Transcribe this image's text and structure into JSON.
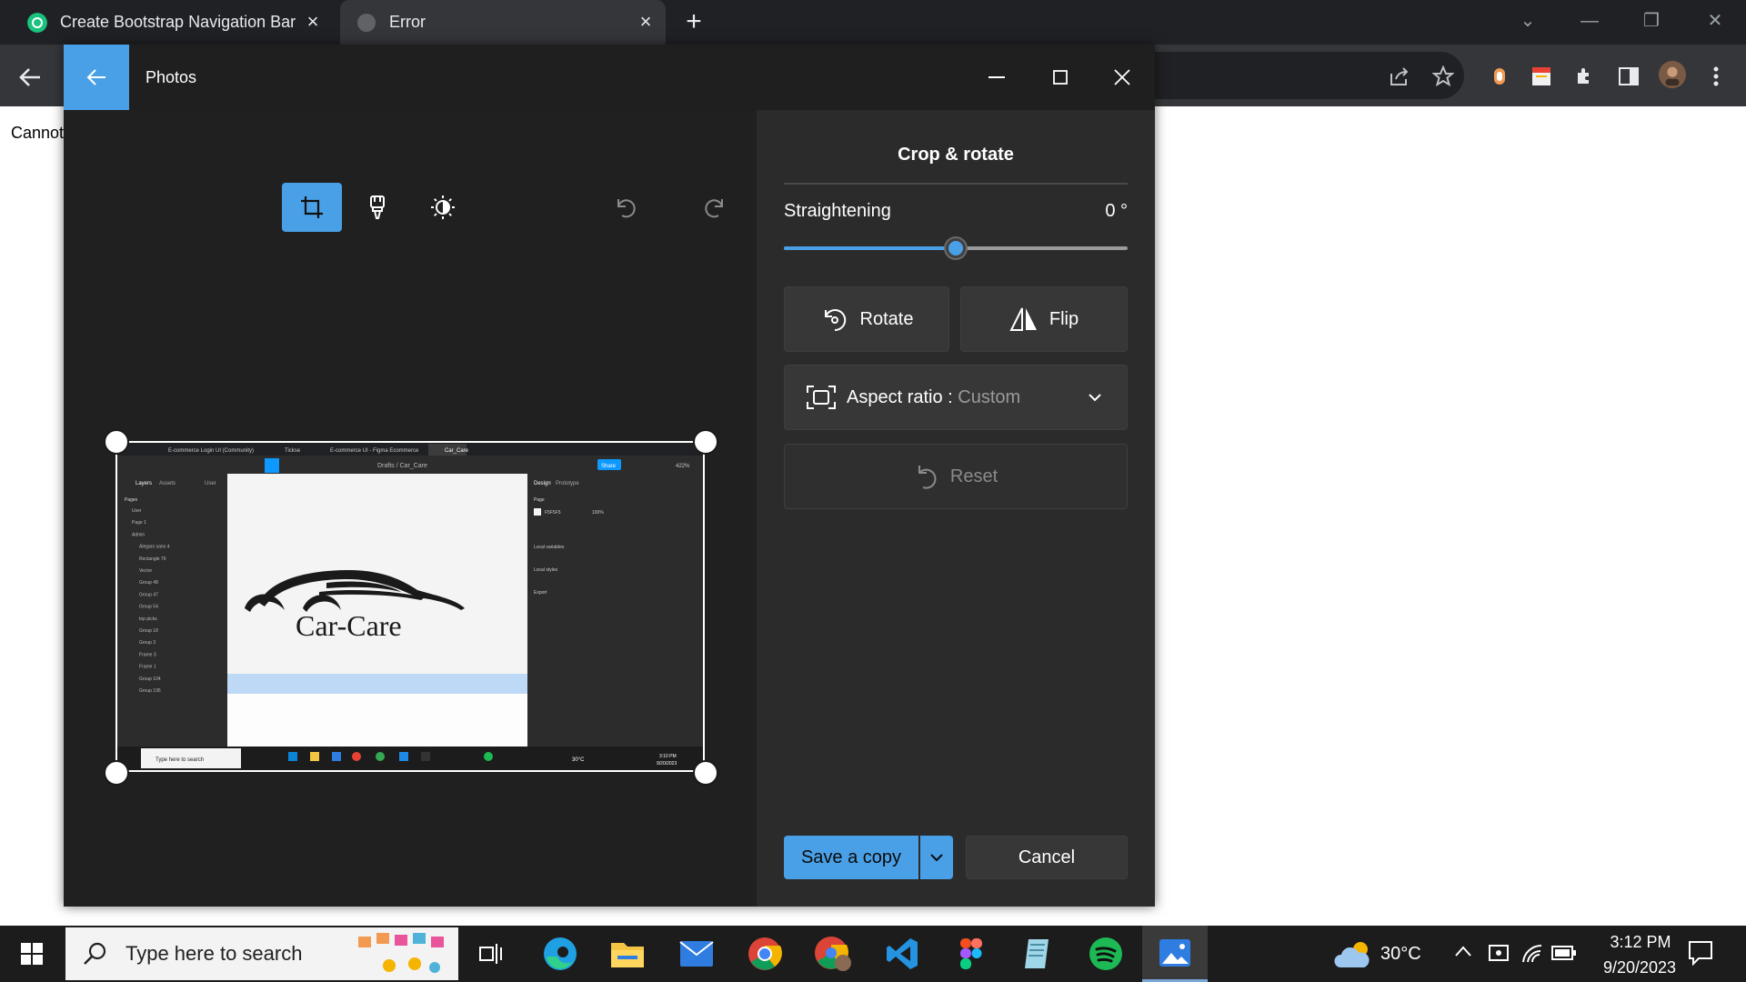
{
  "browser": {
    "tabs": [
      {
        "title": "Create Bootstrap Navigation Bar",
        "active": false
      },
      {
        "title": "Error",
        "active": true
      }
    ],
    "page_text": "Cannot"
  },
  "photos": {
    "app_title": "Photos",
    "panel_title": "Crop & rotate",
    "straightening_label": "Straightening",
    "straightening_value": "0 °",
    "straightening_level": 0.5,
    "rotate_label": "Rotate",
    "flip_label": "Flip",
    "aspect_label": "Aspect ratio : ",
    "aspect_value": "Custom",
    "reset_label": "Reset",
    "save_label": "Save a copy",
    "cancel_label": "Cancel",
    "accent_color": "#4aa0e6"
  },
  "preview": {
    "tabs": [
      "E-commerce Login UI (Community)",
      "Tickse",
      "E-commerce UI - Figma Ecommerce",
      "Car_Care"
    ],
    "path": "Drafts / Car_Care",
    "share_label": "Share",
    "zoom": "422%",
    "left_tabs": [
      "Layers",
      "Assets",
      "User"
    ],
    "pages_label": "Pages",
    "layers": [
      "User",
      "Page 1",
      "Admin",
      "Alegaro sans 4",
      "Rectangle 79",
      "Vector",
      "Group 48",
      "Group 47",
      "Group 54",
      "top picks",
      "Group 18",
      "Group 3",
      "Frame 3",
      "Frame 1",
      "Group 104",
      "Group 195"
    ],
    "right_tabs": [
      "Design",
      "Prototype"
    ],
    "right_items": [
      "Page",
      "F5F5F5",
      "100%",
      "Local variables",
      "Local styles",
      "Export"
    ],
    "logo_text": "Car-Care",
    "search_placeholder": "Type here to search",
    "weather": "30°C",
    "time": "3:10 PM",
    "date": "9/20/2023"
  },
  "taskbar": {
    "search_placeholder": "Type here to search",
    "weather": "30°C",
    "time": "3:12 PM",
    "date": "9/20/2023",
    "apps": [
      "task-view",
      "edge",
      "file-explorer",
      "mail",
      "chrome",
      "chrome-profile",
      "vscode",
      "figma",
      "notepad",
      "spotify",
      "photos"
    ]
  }
}
